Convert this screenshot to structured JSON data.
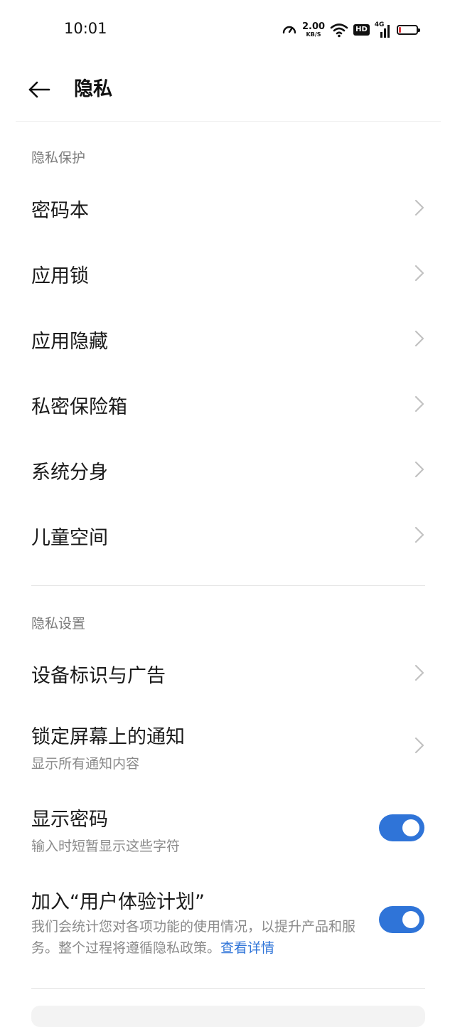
{
  "status_bar": {
    "time": "10:01",
    "net_speed_value": "2.00",
    "net_speed_unit": "KB/S",
    "hd_label": "HD",
    "network_type": "4G",
    "battery_color": "#e0393e"
  },
  "header": {
    "title": "隐私"
  },
  "privacy_protection": {
    "title": "隐私保护",
    "items": [
      {
        "label": "密码本"
      },
      {
        "label": "应用锁"
      },
      {
        "label": "应用隐藏"
      },
      {
        "label": "私密保险箱"
      },
      {
        "label": "系统分身"
      },
      {
        "label": "儿童空间"
      }
    ]
  },
  "privacy_settings": {
    "title": "隐私设置",
    "device_ads": {
      "label": "设备标识与广告"
    },
    "lock_notifications": {
      "label": "锁定屏幕上的通知",
      "subtitle": "显示所有通知内容"
    },
    "show_password": {
      "label": "显示密码",
      "subtitle": "输入时短暂显示这些字符",
      "enabled": true
    },
    "ux_program": {
      "label": "加入“用户体验计划”",
      "description": "我们会统计您对各项功能的使用情况，以提升产品和服务。整个过程将遵循隐私政策。",
      "link_text": "查看详情",
      "enabled": true
    }
  },
  "colors": {
    "accent": "#2f74d8",
    "section_title": "#7a7a7a"
  }
}
